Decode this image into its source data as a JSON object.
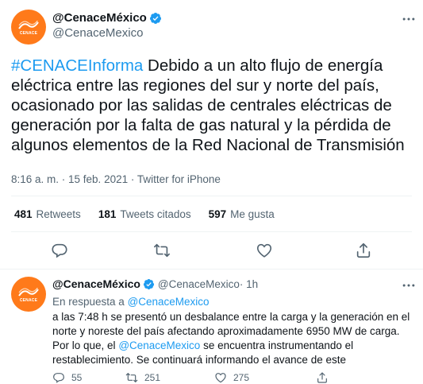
{
  "main_tweet": {
    "display_name": "@CenaceMéxico",
    "handle": "@CenaceMexico",
    "avatar_text": "CENACE",
    "hashtag": "#CENACEInforma",
    "text": " Debido a un alto flujo de energía eléctrica entre las regiones del sur y norte del país, ocasionado por las salidas de centrales eléctricas de generación por la falta de gas natural y la pérdida de algunos elementos de la Red Nacional de Transmisión",
    "meta": "8:16 a. m. · 15 feb. 2021 · Twitter for iPhone",
    "stats": [
      {
        "number": "481",
        "label": "Retweets"
      },
      {
        "number": "181",
        "label": "Tweets citados"
      },
      {
        "number": "597",
        "label": "Me gusta"
      }
    ]
  },
  "reply_tweet": {
    "display_name": "@CenaceMéxico",
    "handle": "@CenaceMexico",
    "time": " · 1h",
    "avatar_text": "CENACE",
    "in_reply_prefix": "En respuesta a ",
    "in_reply_mention": "@CenaceMexico",
    "text_part1": "a las 7:48 h se presentó un desbalance entre la carga y la generación en el norte y noreste del país afectando aproximadamente 6950 MW de carga. Por lo que, el ",
    "text_mention": "@CenaceMexico",
    "text_part2": " se encuentra instrumentando el restablecimiento. Se continuará informando el avance de este",
    "actions": {
      "replies": "55",
      "retweets": "251",
      "likes": "275"
    }
  },
  "colors": {
    "accent": "#1d9bf0",
    "brand_orange": "#ff7a1a",
    "muted": "#536471"
  }
}
